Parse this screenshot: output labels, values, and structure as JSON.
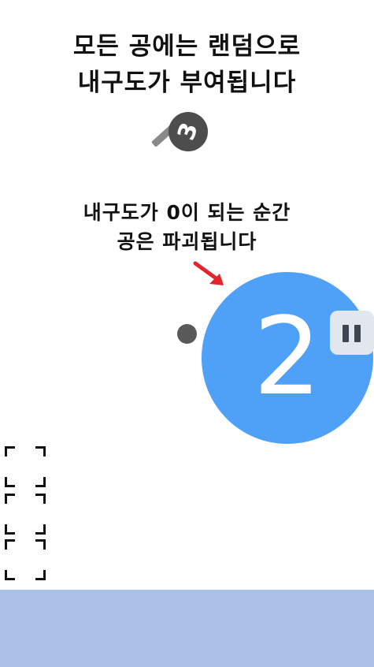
{
  "tutorial": {
    "line1": "모든 공에는 랜덤으로",
    "line2": "내구도가 부여됩니다",
    "line3": "내구도가 0이 되는 순간",
    "line4": "공은 파괴됩니다"
  },
  "magnifier": {
    "icon": "magnifier-icon",
    "value": "3"
  },
  "ball": {
    "durability": "2",
    "color": "#4ea1f7"
  },
  "arrow": {
    "icon": "arrow-icon",
    "color": "#e3242b"
  },
  "pause": {
    "icon": "pause-icon"
  },
  "colors": {
    "ball_blue": "#4ea1f7",
    "dot_gray": "#595959",
    "panel_blue": "#abc1e8",
    "pause_bg": "#e2e7ee"
  }
}
